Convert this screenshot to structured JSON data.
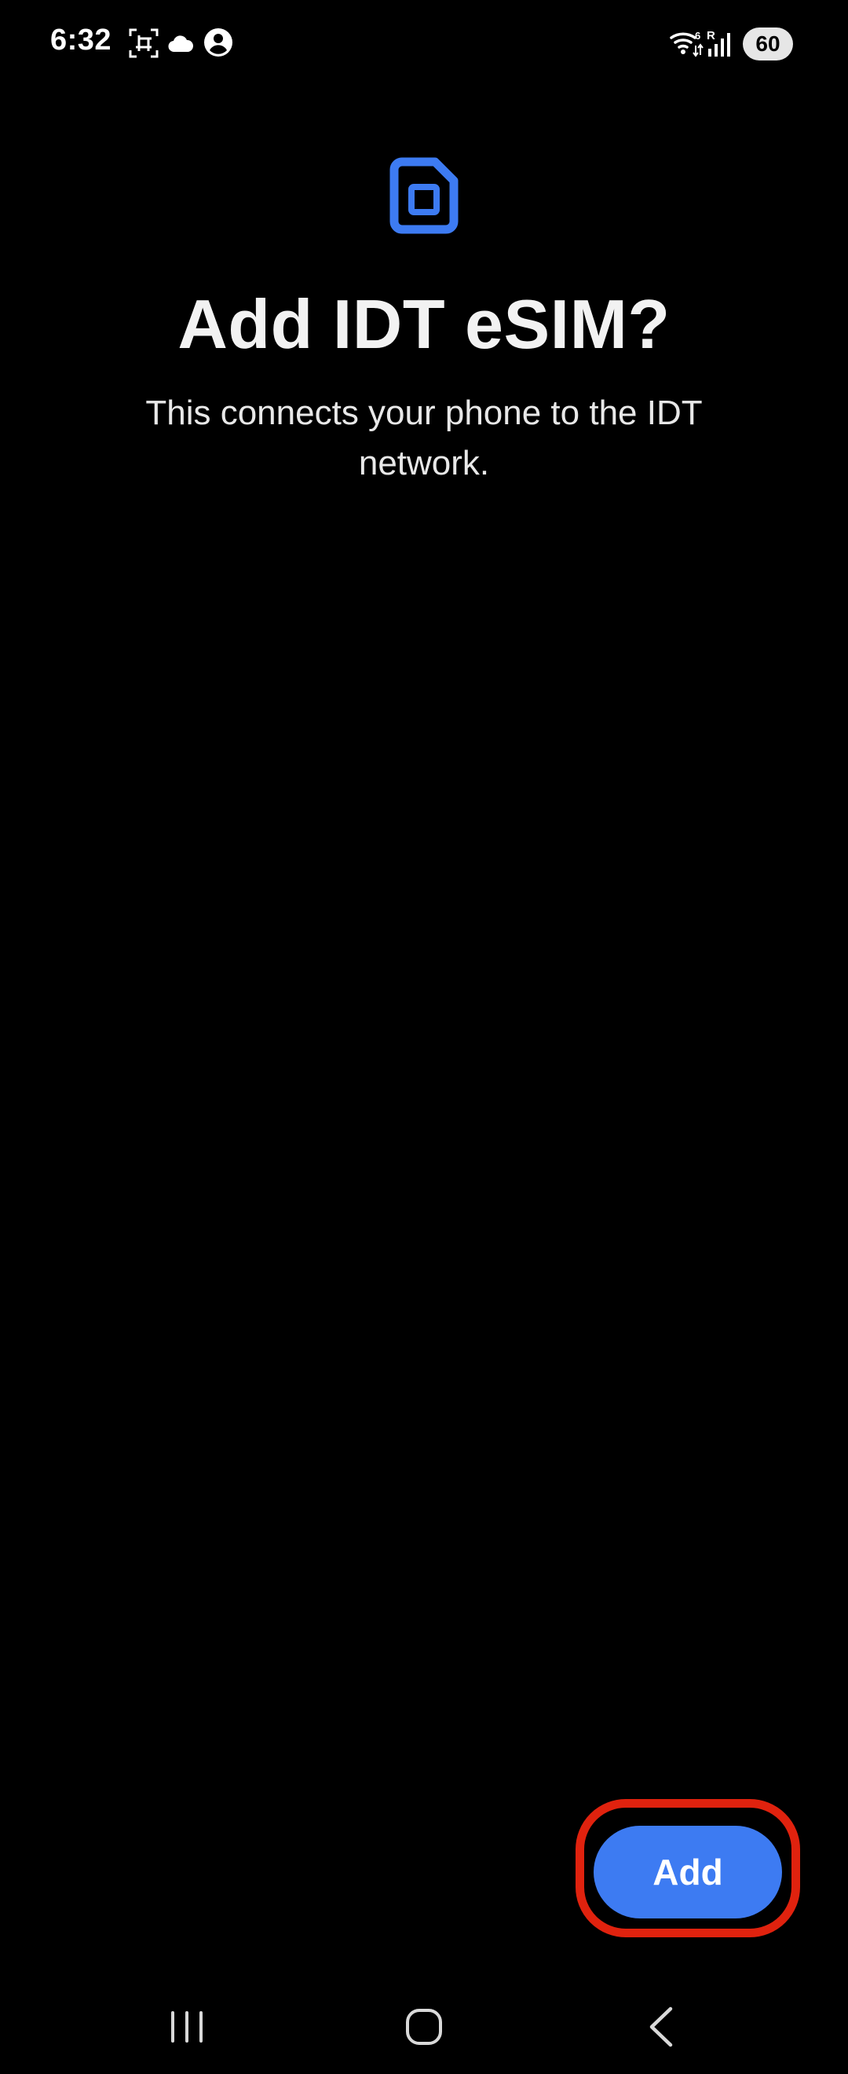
{
  "status_bar": {
    "time": "6:32",
    "battery": "60",
    "icons": [
      "screenshot-icon",
      "cloud-icon",
      "account-icon",
      "wifi-icon",
      "signal-icon"
    ]
  },
  "dialog": {
    "icon": "sim-card-icon",
    "title": "Add IDT eSIM?",
    "description": "This connects your phone to the IDT network."
  },
  "actions": {
    "add_label": "Add"
  },
  "nav": {
    "items": [
      "recents-icon",
      "home-icon",
      "back-icon"
    ]
  },
  "colors": {
    "background": "#000000",
    "accent": "#3d7bf2",
    "highlight": "#e0220e"
  }
}
